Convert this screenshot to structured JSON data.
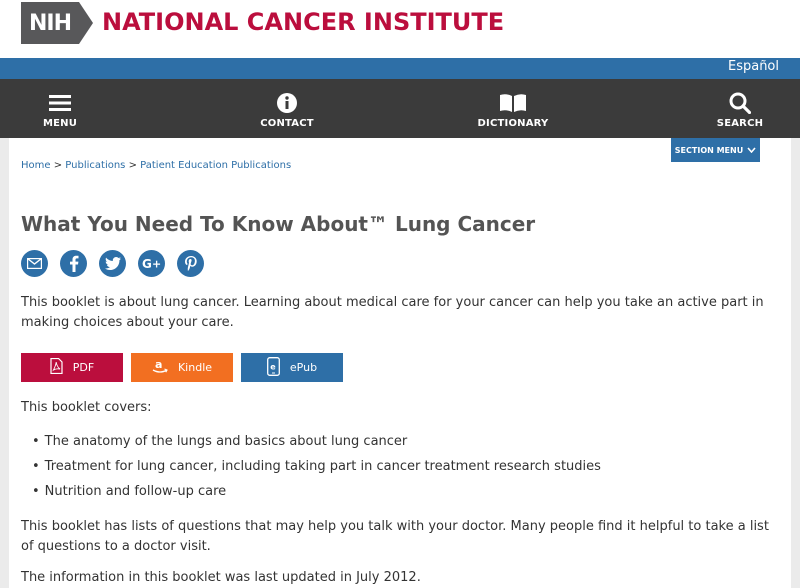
{
  "header": {
    "nih_logo_text": "NIH",
    "institute_name": "NATIONAL CANCER INSTITUTE"
  },
  "lang_link": "Español",
  "nav": {
    "menu": "MENU",
    "contact": "CONTACT",
    "dictionary": "DICTIONARY",
    "search": "SEARCH"
  },
  "section_menu": "SECTION MENU",
  "breadcrumb": {
    "home": "Home",
    "publications": "Publications",
    "patient_ed": "Patient Education Publications",
    "separator": ">"
  },
  "title": "What You Need To Know About™ Lung Cancer",
  "share_icons": [
    "email-icon",
    "facebook-icon",
    "twitter-icon",
    "google-plus-icon",
    "pinterest-icon"
  ],
  "intro": "This booklet is about lung cancer. Learning about medical care for your cancer can help you take an active part in making choices about your care.",
  "buttons": {
    "pdf": "PDF",
    "kindle": "Kindle",
    "epub": "ePub"
  },
  "covers_heading": "This booklet covers:",
  "covers": [
    "The anatomy of the lungs and basics about lung cancer",
    "Treatment for lung cancer, including taking part in cancer treatment research studies",
    "Nutrition and follow-up care"
  ],
  "para2": "This booklet has lists of questions that may help you talk with your doctor. Many people find it helpful to take a list of questions to a doctor visit.",
  "para3": "The information in this booklet was last updated in July 2012.",
  "colors": {
    "brand_red": "#bb0e3d",
    "brand_blue": "#2e6fa7",
    "nav_dark": "#3b3b3b",
    "kindle_orange": "#f26f21"
  }
}
